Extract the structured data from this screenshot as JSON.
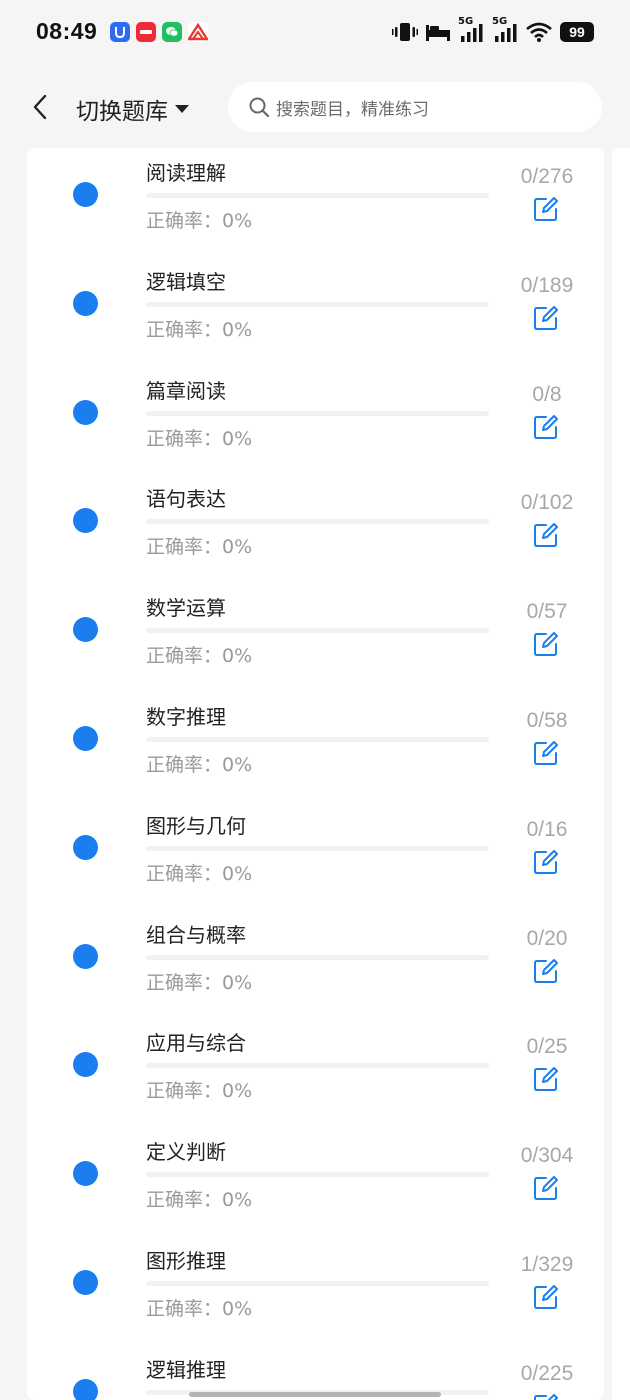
{
  "status_bar": {
    "time": "08:49",
    "battery": "99",
    "network_5g_1": "5G",
    "network_5g_2": "5G"
  },
  "header": {
    "bank_switch_label": "切换题库",
    "search_placeholder": "搜索题目，精准练习"
  },
  "colors": {
    "accent": "#1a7ef0",
    "muted_text": "#9a9a9a",
    "count_text": "#a8a8a8"
  },
  "accuracy_label": "正确率：",
  "categories": [
    {
      "name": "阅读理解",
      "accuracy": "0%",
      "count": "0/276",
      "progress": 0
    },
    {
      "name": "逻辑填空",
      "accuracy": "0%",
      "count": "0/189",
      "progress": 0
    },
    {
      "name": "篇章阅读",
      "accuracy": "0%",
      "count": "0/8",
      "progress": 0
    },
    {
      "name": "语句表达",
      "accuracy": "0%",
      "count": "0/102",
      "progress": 0
    },
    {
      "name": "数学运算",
      "accuracy": "0%",
      "count": "0/57",
      "progress": 0
    },
    {
      "name": "数字推理",
      "accuracy": "0%",
      "count": "0/58",
      "progress": 0
    },
    {
      "name": "图形与几何",
      "accuracy": "0%",
      "count": "0/16",
      "progress": 0
    },
    {
      "name": "组合与概率",
      "accuracy": "0%",
      "count": "0/20",
      "progress": 0
    },
    {
      "name": "应用与综合",
      "accuracy": "0%",
      "count": "0/25",
      "progress": 0
    },
    {
      "name": "定义判断",
      "accuracy": "0%",
      "count": "0/304",
      "progress": 0
    },
    {
      "name": "图形推理",
      "accuracy": "0%",
      "count": "1/329",
      "progress": 0
    },
    {
      "name": "逻辑推理",
      "accuracy": "",
      "count": "0/225",
      "progress": 0
    }
  ]
}
